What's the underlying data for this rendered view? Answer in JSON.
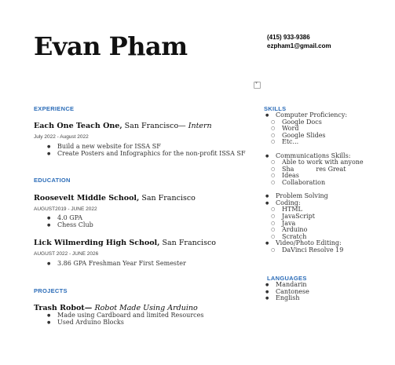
{
  "header": {
    "name": "Evan Pham",
    "phone": "(415) 933-9386",
    "email": "ezpham1@gmail.com"
  },
  "experience": {
    "heading": "EXPERIENCE",
    "org": "Each One Teach One,",
    "location": " San Francisco— ",
    "role": "Intern",
    "dates": "July 2022 - August 2022",
    "bullets": [
      "Build a new website for ISSA SF",
      "Create Posters and Infographics for the non-profit ISSA SF"
    ]
  },
  "education": {
    "heading": "EDUCATION",
    "schools": [
      {
        "name": "Roosevelt Middle School,",
        "location": " San Francisco",
        "dates": "AUGUST2019 - JUNE 2022",
        "bullets": [
          "4.0 GPA",
          "Chess Club"
        ]
      },
      {
        "name": "Lick Wilmerding High School,",
        "location": " San Francisco",
        "dates": "AUGUST 2022 - JUNE 2026",
        "bullets": [
          "3.86 GPA Freshman Year First Semester"
        ]
      }
    ]
  },
  "projects": {
    "heading": "PROJECTS",
    "title": "Trash Robot— ",
    "subtitle": "Robot Made Using Arduino",
    "bullets": [
      "Made using Cardboard and limited Resources",
      "Used Arduino Blocks"
    ]
  },
  "skills": {
    "heading": "SKILLS",
    "computer": "Computer Proficiency:",
    "computer_items": [
      "Google Docs",
      "Word",
      "Google Slides",
      "Etc..."
    ],
    "communications": "Communications Skills:",
    "communications_items": [
      "Able to work with anyone",
      "Sha           res Great",
      "Ideas",
      "Collaboration"
    ],
    "problem_solving": "Problem Solving",
    "coding": "Coding:",
    "coding_items": [
      "HTML",
      "JavaScript",
      "Java",
      "Arduino",
      "Scratch"
    ],
    "video": "Video/Photo Editing:",
    "video_items": [
      "DaVinci Resolve 19"
    ]
  },
  "languages": {
    "heading": "LANGUAGES",
    "items": [
      "Mandarin",
      "Cantonese",
      "English"
    ]
  }
}
